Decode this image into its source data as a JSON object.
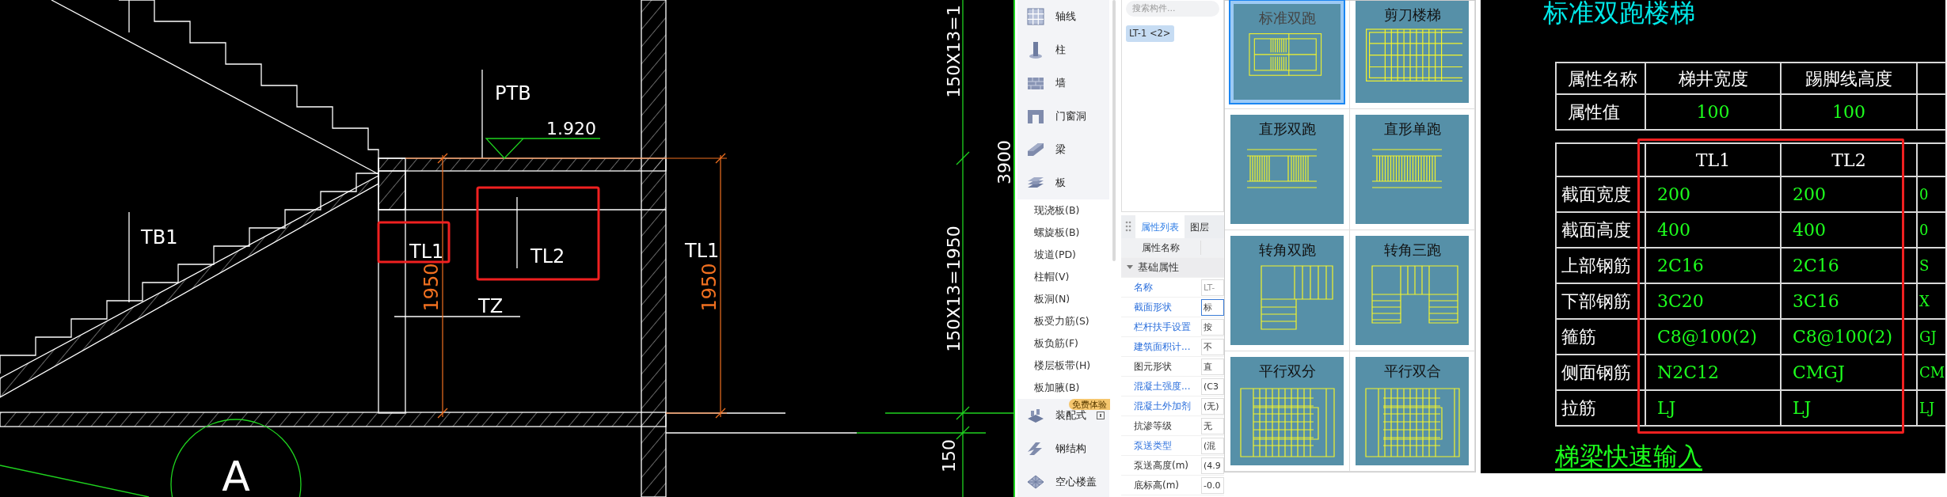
{
  "cad_drawing": {
    "labels": [
      {
        "text": "PTB",
        "kind": "tag",
        "highlighted": false
      },
      {
        "text": "1.920",
        "kind": "elevation",
        "highlighted": false
      },
      {
        "text": "TB1",
        "kind": "tag",
        "highlighted": false
      },
      {
        "text": "TL1",
        "kind": "tag",
        "highlighted": true
      },
      {
        "text": "TL2",
        "kind": "tag",
        "highlighted": true
      },
      {
        "text": "TZ",
        "kind": "tag",
        "highlighted": false
      },
      {
        "text": "TL1",
        "kind": "tag",
        "highlighted": false
      },
      {
        "text": "1950",
        "kind": "dimension",
        "highlighted": false
      },
      {
        "text": "1950",
        "kind": "dimension",
        "highlighted": false
      },
      {
        "text": "150X13=1",
        "kind": "axis-dimension",
        "highlighted": false
      },
      {
        "text": "3900",
        "kind": "axis-dimension",
        "highlighted": false
      },
      {
        "text": "150X13=1950",
        "kind": "axis-dimension",
        "highlighted": false
      },
      {
        "text": "150",
        "kind": "axis-dimension",
        "highlighted": false
      },
      {
        "text": "A",
        "kind": "axis",
        "highlighted": false
      }
    ]
  },
  "sidebar": {
    "categories": [
      {
        "label": "轴线",
        "kind": "axis"
      },
      {
        "label": "柱",
        "kind": "column"
      },
      {
        "label": "墙",
        "kind": "wall"
      },
      {
        "label": "门窗洞",
        "kind": "opening"
      },
      {
        "label": "梁",
        "kind": "beam"
      },
      {
        "label": "板",
        "kind": "slab",
        "children": [
          {
            "label": "现浇板(B)"
          },
          {
            "label": "螺旋板(B)"
          },
          {
            "label": "坡道(PD)"
          },
          {
            "label": "柱帽(V)"
          },
          {
            "label": "板洞(N)"
          },
          {
            "label": "板受力筋(S)"
          },
          {
            "label": "板负筋(F)"
          },
          {
            "label": "楼层板带(H)"
          },
          {
            "label": "板加腋(B)"
          }
        ]
      },
      {
        "label": "装配式",
        "kind": "prefab",
        "badge": "免费体验"
      },
      {
        "label": "钢结构",
        "kind": "steel"
      },
      {
        "label": "空心楼盖",
        "kind": "hollow-floor"
      }
    ]
  },
  "component_panel": {
    "search": {
      "placeholder": "搜索构件..."
    },
    "components": [
      {
        "label": "LT-1 <2>",
        "selected": true
      }
    ]
  },
  "property_panel": {
    "tabs": [
      {
        "label": "属性列表",
        "selected": true
      },
      {
        "label": "图层",
        "selected": false
      }
    ],
    "name_header": "属性名称",
    "group": {
      "label": "基础属性"
    },
    "rows": [
      {
        "name": "名称",
        "value": "LT-",
        "public": true,
        "focused": false
      },
      {
        "name": "截面形状",
        "value": "标",
        "public": true,
        "focused": true
      },
      {
        "name": "栏杆扶手设置",
        "value": "按",
        "public": true,
        "focused": false
      },
      {
        "name": "建筑面积计...",
        "value": "不",
        "public": true,
        "focused": false
      },
      {
        "name": "图元形状",
        "value": "直",
        "public": false,
        "focused": false
      },
      {
        "name": "混凝土强度...",
        "value": "(C3",
        "public": true,
        "focused": false
      },
      {
        "name": "混凝土外加剂",
        "value": "(无)",
        "public": true,
        "focused": false
      },
      {
        "name": "抗渗等级",
        "value": "无",
        "public": false,
        "focused": false
      },
      {
        "name": "泵送类型",
        "value": "(混",
        "public": true,
        "focused": false
      },
      {
        "name": "泵送高度(m)",
        "value": "(4.9",
        "public": false,
        "focused": false
      },
      {
        "name": "底标高(m)",
        "value": "-0.0",
        "public": false,
        "focused": false
      }
    ]
  },
  "stair_types": {
    "tiles": [
      {
        "label": "标准双跑",
        "kind": "standard",
        "selected": true
      },
      {
        "label": "剪刀楼梯",
        "kind": "scissor",
        "selected": false
      },
      {
        "label": "直形双跑",
        "kind": "straight-double",
        "selected": false
      },
      {
        "label": "直形单跑",
        "kind": "straight-single",
        "selected": false
      },
      {
        "label": "转角双跑",
        "kind": "corner-double",
        "selected": false
      },
      {
        "label": "转角三跑",
        "kind": "corner-triple",
        "selected": false
      },
      {
        "label": "平行双分",
        "kind": "parallel-split",
        "selected": false
      },
      {
        "label": "平行双合",
        "kind": "parallel-merge",
        "selected": false
      }
    ]
  },
  "preview": {
    "title": "标准双跑楼梯",
    "property_table": {
      "header_label": "属性名称",
      "value_label": "属性值",
      "columns": [
        {
          "label": "梯井宽度",
          "value": "100"
        },
        {
          "label": "踢脚线高度",
          "value": "100"
        }
      ]
    },
    "beam_table": {
      "columns": [
        {
          "label": "TL1",
          "highlighted": true
        },
        {
          "label": "TL2",
          "highlighted": true
        },
        {
          "highlighted": false
        }
      ],
      "rows": [
        {
          "label": "截面宽度",
          "cells": [
            "200",
            "200",
            "0"
          ]
        },
        {
          "label": "截面高度",
          "cells": [
            "400",
            "400",
            "0"
          ]
        },
        {
          "label": "上部钢筋",
          "cells": [
            "2C16",
            "2C16",
            "S"
          ]
        },
        {
          "label": "下部钢筋",
          "cells": [
            "3C20",
            "3C16",
            "X"
          ]
        },
        {
          "label": "箍筋",
          "cells": [
            "C8@100(2)",
            "C8@100(2)",
            "GJ"
          ]
        },
        {
          "label": "侧面钢筋",
          "cells": [
            "N2C12",
            "CMGJ",
            "CM"
          ]
        },
        {
          "label": "拉筋",
          "cells": [
            "LJ",
            "LJ",
            "LJ"
          ]
        }
      ]
    },
    "link": "梯梁快速输入"
  }
}
